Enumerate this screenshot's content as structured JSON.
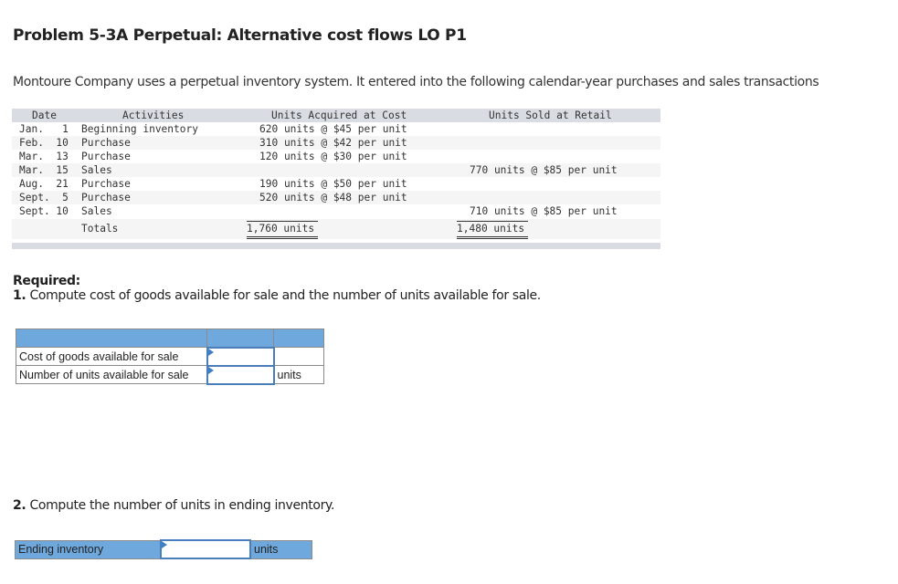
{
  "title": "Problem 5-3A Perpetual: Alternative cost flows LO P1",
  "intro": "Montoure Company uses a perpetual inventory system. It entered into the following calendar-year purchases and sales transactions",
  "ledger": {
    "headers": {
      "date": "Date",
      "activities": "Activities",
      "acquired": "Units Acquired at Cost",
      "sold": "Units Sold at Retail"
    },
    "rows": [
      {
        "date": "Jan.   1",
        "activity": "Beginning inventory",
        "acquired": "620 units @ $45 per unit",
        "sold": ""
      },
      {
        "date": "Feb.  10",
        "activity": "Purchase",
        "acquired": "310 units @ $42 per unit",
        "sold": ""
      },
      {
        "date": "Mar.  13",
        "activity": "Purchase",
        "acquired": "120 units @ $30 per unit",
        "sold": ""
      },
      {
        "date": "Mar.  15",
        "activity": "Sales",
        "acquired": "",
        "sold": "770 units @ $85 per unit"
      },
      {
        "date": "Aug.  21",
        "activity": "Purchase",
        "acquired": "190 units @ $50 per unit",
        "sold": ""
      },
      {
        "date": "Sept.  5",
        "activity": "Purchase",
        "acquired": "520 units @ $48 per unit",
        "sold": ""
      },
      {
        "date": "Sept. 10",
        "activity": "Sales",
        "acquired": "",
        "sold": "710 units @ $85 per unit"
      }
    ],
    "totals": {
      "label": "Totals",
      "acquired": "1,760 units",
      "sold": "1,480 units"
    }
  },
  "required": {
    "heading": "Required:",
    "q1_num": "1.",
    "q1_text": " Compute cost of goods available for sale and the number of units available for sale.",
    "q1_rows": [
      {
        "label": "Cost of goods available for sale",
        "value": "",
        "unit": ""
      },
      {
        "label": "Number of units available for sale",
        "value": "",
        "unit": "units"
      }
    ],
    "q2_num": "2.",
    "q2_text": " Compute the number of units in ending inventory.",
    "q2_row": {
      "label": "Ending inventory",
      "value": "",
      "unit": "units"
    }
  }
}
